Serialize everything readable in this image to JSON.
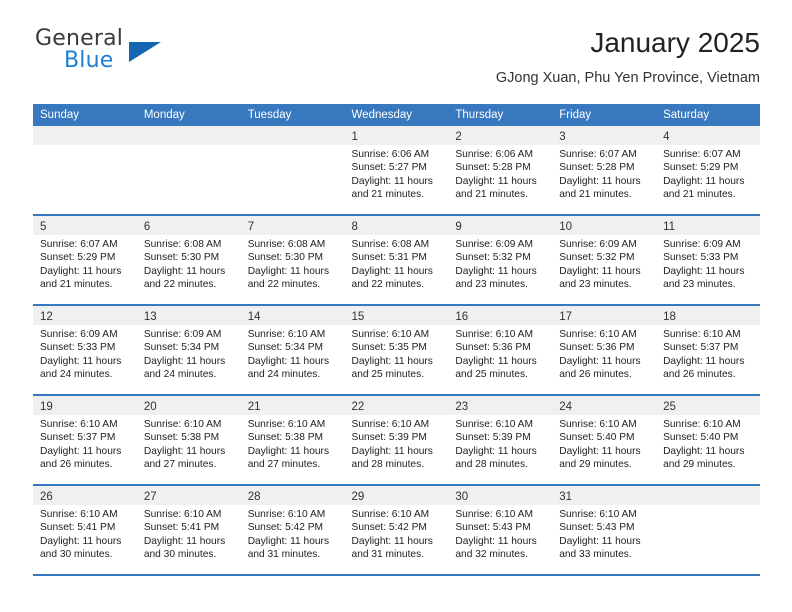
{
  "brand": {
    "name_top": "General",
    "name_bottom": "Blue",
    "triangle_color": "#1566b0",
    "blue_color": "#1b7fd4"
  },
  "header": {
    "title": "January 2025",
    "subtitle": "GJong Xuan, Phu Yen Province, Vietnam"
  },
  "theme": {
    "header_bg": "#3778be",
    "header_text": "#ffffff",
    "daynum_band_bg": "#f0f0f0",
    "row_divider": "#3778be"
  },
  "weekdays": [
    "Sunday",
    "Monday",
    "Tuesday",
    "Wednesday",
    "Thursday",
    "Friday",
    "Saturday"
  ],
  "labels": {
    "sunrise_prefix": "Sunrise:",
    "sunset_prefix": "Sunset:",
    "daylight_prefix": "Daylight:"
  },
  "weeks": [
    [
      {
        "day": "",
        "empty": true
      },
      {
        "day": "",
        "empty": true
      },
      {
        "day": "",
        "empty": true
      },
      {
        "day": "1",
        "sunrise": "Sunrise: 6:06 AM",
        "sunset": "Sunset: 5:27 PM",
        "daylight1": "Daylight: 11 hours",
        "daylight2": "and 21 minutes."
      },
      {
        "day": "2",
        "sunrise": "Sunrise: 6:06 AM",
        "sunset": "Sunset: 5:28 PM",
        "daylight1": "Daylight: 11 hours",
        "daylight2": "and 21 minutes."
      },
      {
        "day": "3",
        "sunrise": "Sunrise: 6:07 AM",
        "sunset": "Sunset: 5:28 PM",
        "daylight1": "Daylight: 11 hours",
        "daylight2": "and 21 minutes."
      },
      {
        "day": "4",
        "sunrise": "Sunrise: 6:07 AM",
        "sunset": "Sunset: 5:29 PM",
        "daylight1": "Daylight: 11 hours",
        "daylight2": "and 21 minutes."
      }
    ],
    [
      {
        "day": "5",
        "sunrise": "Sunrise: 6:07 AM",
        "sunset": "Sunset: 5:29 PM",
        "daylight1": "Daylight: 11 hours",
        "daylight2": "and 21 minutes."
      },
      {
        "day": "6",
        "sunrise": "Sunrise: 6:08 AM",
        "sunset": "Sunset: 5:30 PM",
        "daylight1": "Daylight: 11 hours",
        "daylight2": "and 22 minutes."
      },
      {
        "day": "7",
        "sunrise": "Sunrise: 6:08 AM",
        "sunset": "Sunset: 5:30 PM",
        "daylight1": "Daylight: 11 hours",
        "daylight2": "and 22 minutes."
      },
      {
        "day": "8",
        "sunrise": "Sunrise: 6:08 AM",
        "sunset": "Sunset: 5:31 PM",
        "daylight1": "Daylight: 11 hours",
        "daylight2": "and 22 minutes."
      },
      {
        "day": "9",
        "sunrise": "Sunrise: 6:09 AM",
        "sunset": "Sunset: 5:32 PM",
        "daylight1": "Daylight: 11 hours",
        "daylight2": "and 23 minutes."
      },
      {
        "day": "10",
        "sunrise": "Sunrise: 6:09 AM",
        "sunset": "Sunset: 5:32 PM",
        "daylight1": "Daylight: 11 hours",
        "daylight2": "and 23 minutes."
      },
      {
        "day": "11",
        "sunrise": "Sunrise: 6:09 AM",
        "sunset": "Sunset: 5:33 PM",
        "daylight1": "Daylight: 11 hours",
        "daylight2": "and 23 minutes."
      }
    ],
    [
      {
        "day": "12",
        "sunrise": "Sunrise: 6:09 AM",
        "sunset": "Sunset: 5:33 PM",
        "daylight1": "Daylight: 11 hours",
        "daylight2": "and 24 minutes."
      },
      {
        "day": "13",
        "sunrise": "Sunrise: 6:09 AM",
        "sunset": "Sunset: 5:34 PM",
        "daylight1": "Daylight: 11 hours",
        "daylight2": "and 24 minutes."
      },
      {
        "day": "14",
        "sunrise": "Sunrise: 6:10 AM",
        "sunset": "Sunset: 5:34 PM",
        "daylight1": "Daylight: 11 hours",
        "daylight2": "and 24 minutes."
      },
      {
        "day": "15",
        "sunrise": "Sunrise: 6:10 AM",
        "sunset": "Sunset: 5:35 PM",
        "daylight1": "Daylight: 11 hours",
        "daylight2": "and 25 minutes."
      },
      {
        "day": "16",
        "sunrise": "Sunrise: 6:10 AM",
        "sunset": "Sunset: 5:36 PM",
        "daylight1": "Daylight: 11 hours",
        "daylight2": "and 25 minutes."
      },
      {
        "day": "17",
        "sunrise": "Sunrise: 6:10 AM",
        "sunset": "Sunset: 5:36 PM",
        "daylight1": "Daylight: 11 hours",
        "daylight2": "and 26 minutes."
      },
      {
        "day": "18",
        "sunrise": "Sunrise: 6:10 AM",
        "sunset": "Sunset: 5:37 PM",
        "daylight1": "Daylight: 11 hours",
        "daylight2": "and 26 minutes."
      }
    ],
    [
      {
        "day": "19",
        "sunrise": "Sunrise: 6:10 AM",
        "sunset": "Sunset: 5:37 PM",
        "daylight1": "Daylight: 11 hours",
        "daylight2": "and 26 minutes."
      },
      {
        "day": "20",
        "sunrise": "Sunrise: 6:10 AM",
        "sunset": "Sunset: 5:38 PM",
        "daylight1": "Daylight: 11 hours",
        "daylight2": "and 27 minutes."
      },
      {
        "day": "21",
        "sunrise": "Sunrise: 6:10 AM",
        "sunset": "Sunset: 5:38 PM",
        "daylight1": "Daylight: 11 hours",
        "daylight2": "and 27 minutes."
      },
      {
        "day": "22",
        "sunrise": "Sunrise: 6:10 AM",
        "sunset": "Sunset: 5:39 PM",
        "daylight1": "Daylight: 11 hours",
        "daylight2": "and 28 minutes."
      },
      {
        "day": "23",
        "sunrise": "Sunrise: 6:10 AM",
        "sunset": "Sunset: 5:39 PM",
        "daylight1": "Daylight: 11 hours",
        "daylight2": "and 28 minutes."
      },
      {
        "day": "24",
        "sunrise": "Sunrise: 6:10 AM",
        "sunset": "Sunset: 5:40 PM",
        "daylight1": "Daylight: 11 hours",
        "daylight2": "and 29 minutes."
      },
      {
        "day": "25",
        "sunrise": "Sunrise: 6:10 AM",
        "sunset": "Sunset: 5:40 PM",
        "daylight1": "Daylight: 11 hours",
        "daylight2": "and 29 minutes."
      }
    ],
    [
      {
        "day": "26",
        "sunrise": "Sunrise: 6:10 AM",
        "sunset": "Sunset: 5:41 PM",
        "daylight1": "Daylight: 11 hours",
        "daylight2": "and 30 minutes."
      },
      {
        "day": "27",
        "sunrise": "Sunrise: 6:10 AM",
        "sunset": "Sunset: 5:41 PM",
        "daylight1": "Daylight: 11 hours",
        "daylight2": "and 30 minutes."
      },
      {
        "day": "28",
        "sunrise": "Sunrise: 6:10 AM",
        "sunset": "Sunset: 5:42 PM",
        "daylight1": "Daylight: 11 hours",
        "daylight2": "and 31 minutes."
      },
      {
        "day": "29",
        "sunrise": "Sunrise: 6:10 AM",
        "sunset": "Sunset: 5:42 PM",
        "daylight1": "Daylight: 11 hours",
        "daylight2": "and 31 minutes."
      },
      {
        "day": "30",
        "sunrise": "Sunrise: 6:10 AM",
        "sunset": "Sunset: 5:43 PM",
        "daylight1": "Daylight: 11 hours",
        "daylight2": "and 32 minutes."
      },
      {
        "day": "31",
        "sunrise": "Sunrise: 6:10 AM",
        "sunset": "Sunset: 5:43 PM",
        "daylight1": "Daylight: 11 hours",
        "daylight2": "and 33 minutes."
      },
      {
        "day": "",
        "empty": true
      }
    ]
  ]
}
